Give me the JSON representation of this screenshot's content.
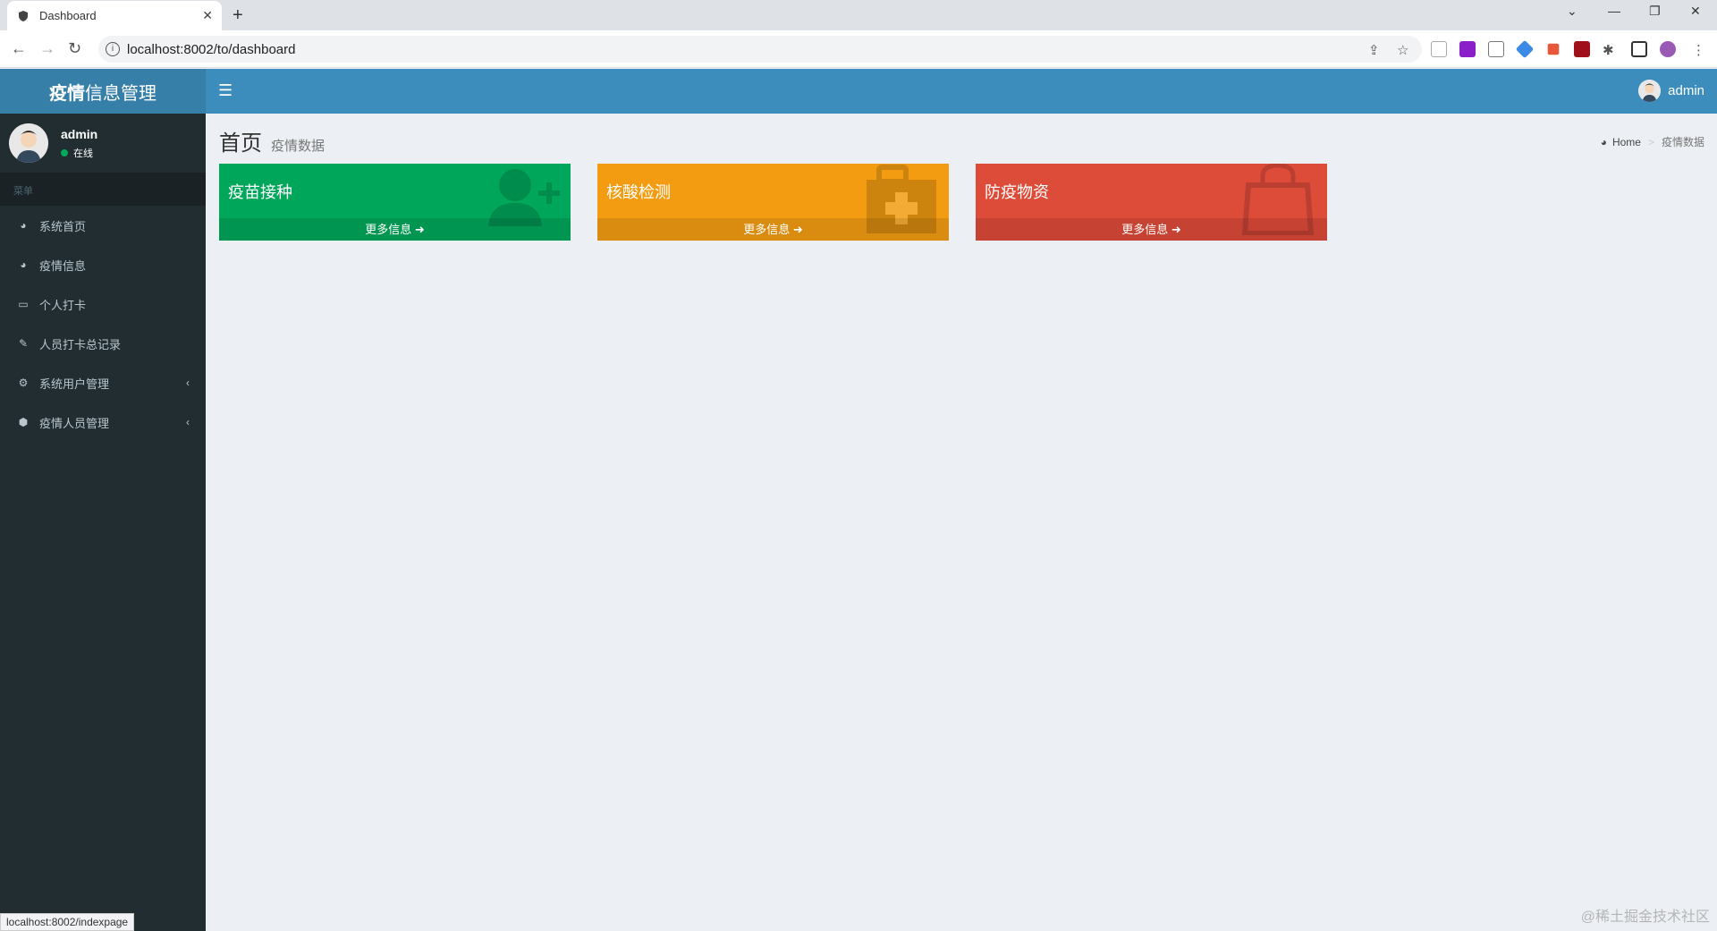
{
  "browser": {
    "tab_title": "Dashboard",
    "url": "localhost:8002/to/dashboard",
    "status_url": "localhost:8002/indexpage"
  },
  "header": {
    "logo_bold": "疫情",
    "logo_rest": "信息管理",
    "user": "admin"
  },
  "sidebar": {
    "user_name": "admin",
    "status": "在线",
    "menu_header": "菜单",
    "items": [
      {
        "label": "系统首页",
        "icon": "dashboard-icon"
      },
      {
        "label": "疫情信息",
        "icon": "dashboard-icon"
      },
      {
        "label": "个人打卡",
        "icon": "laptop-icon"
      },
      {
        "label": "人员打卡总记录",
        "icon": "edit-icon"
      },
      {
        "label": "系统用户管理",
        "icon": "cogs-icon"
      },
      {
        "label": "疫情人员管理",
        "icon": "cube-icon"
      }
    ]
  },
  "content": {
    "title": "首页",
    "subtitle": "疫情数据",
    "breadcrumb_home": "Home",
    "breadcrumb_current": "疫情数据"
  },
  "boxes": [
    {
      "title": "疫苗接种",
      "footer": "更多信息",
      "color": "#00a65a",
      "icon": "user-plus-icon"
    },
    {
      "title": "核酸检测",
      "footer": "更多信息",
      "color": "#f39c12",
      "icon": "medkit-icon"
    },
    {
      "title": "防疫物资",
      "footer": "更多信息",
      "color": "#dd4b39",
      "icon": "shopping-bag-icon"
    }
  ],
  "watermark": "@稀土掘金技术社区"
}
